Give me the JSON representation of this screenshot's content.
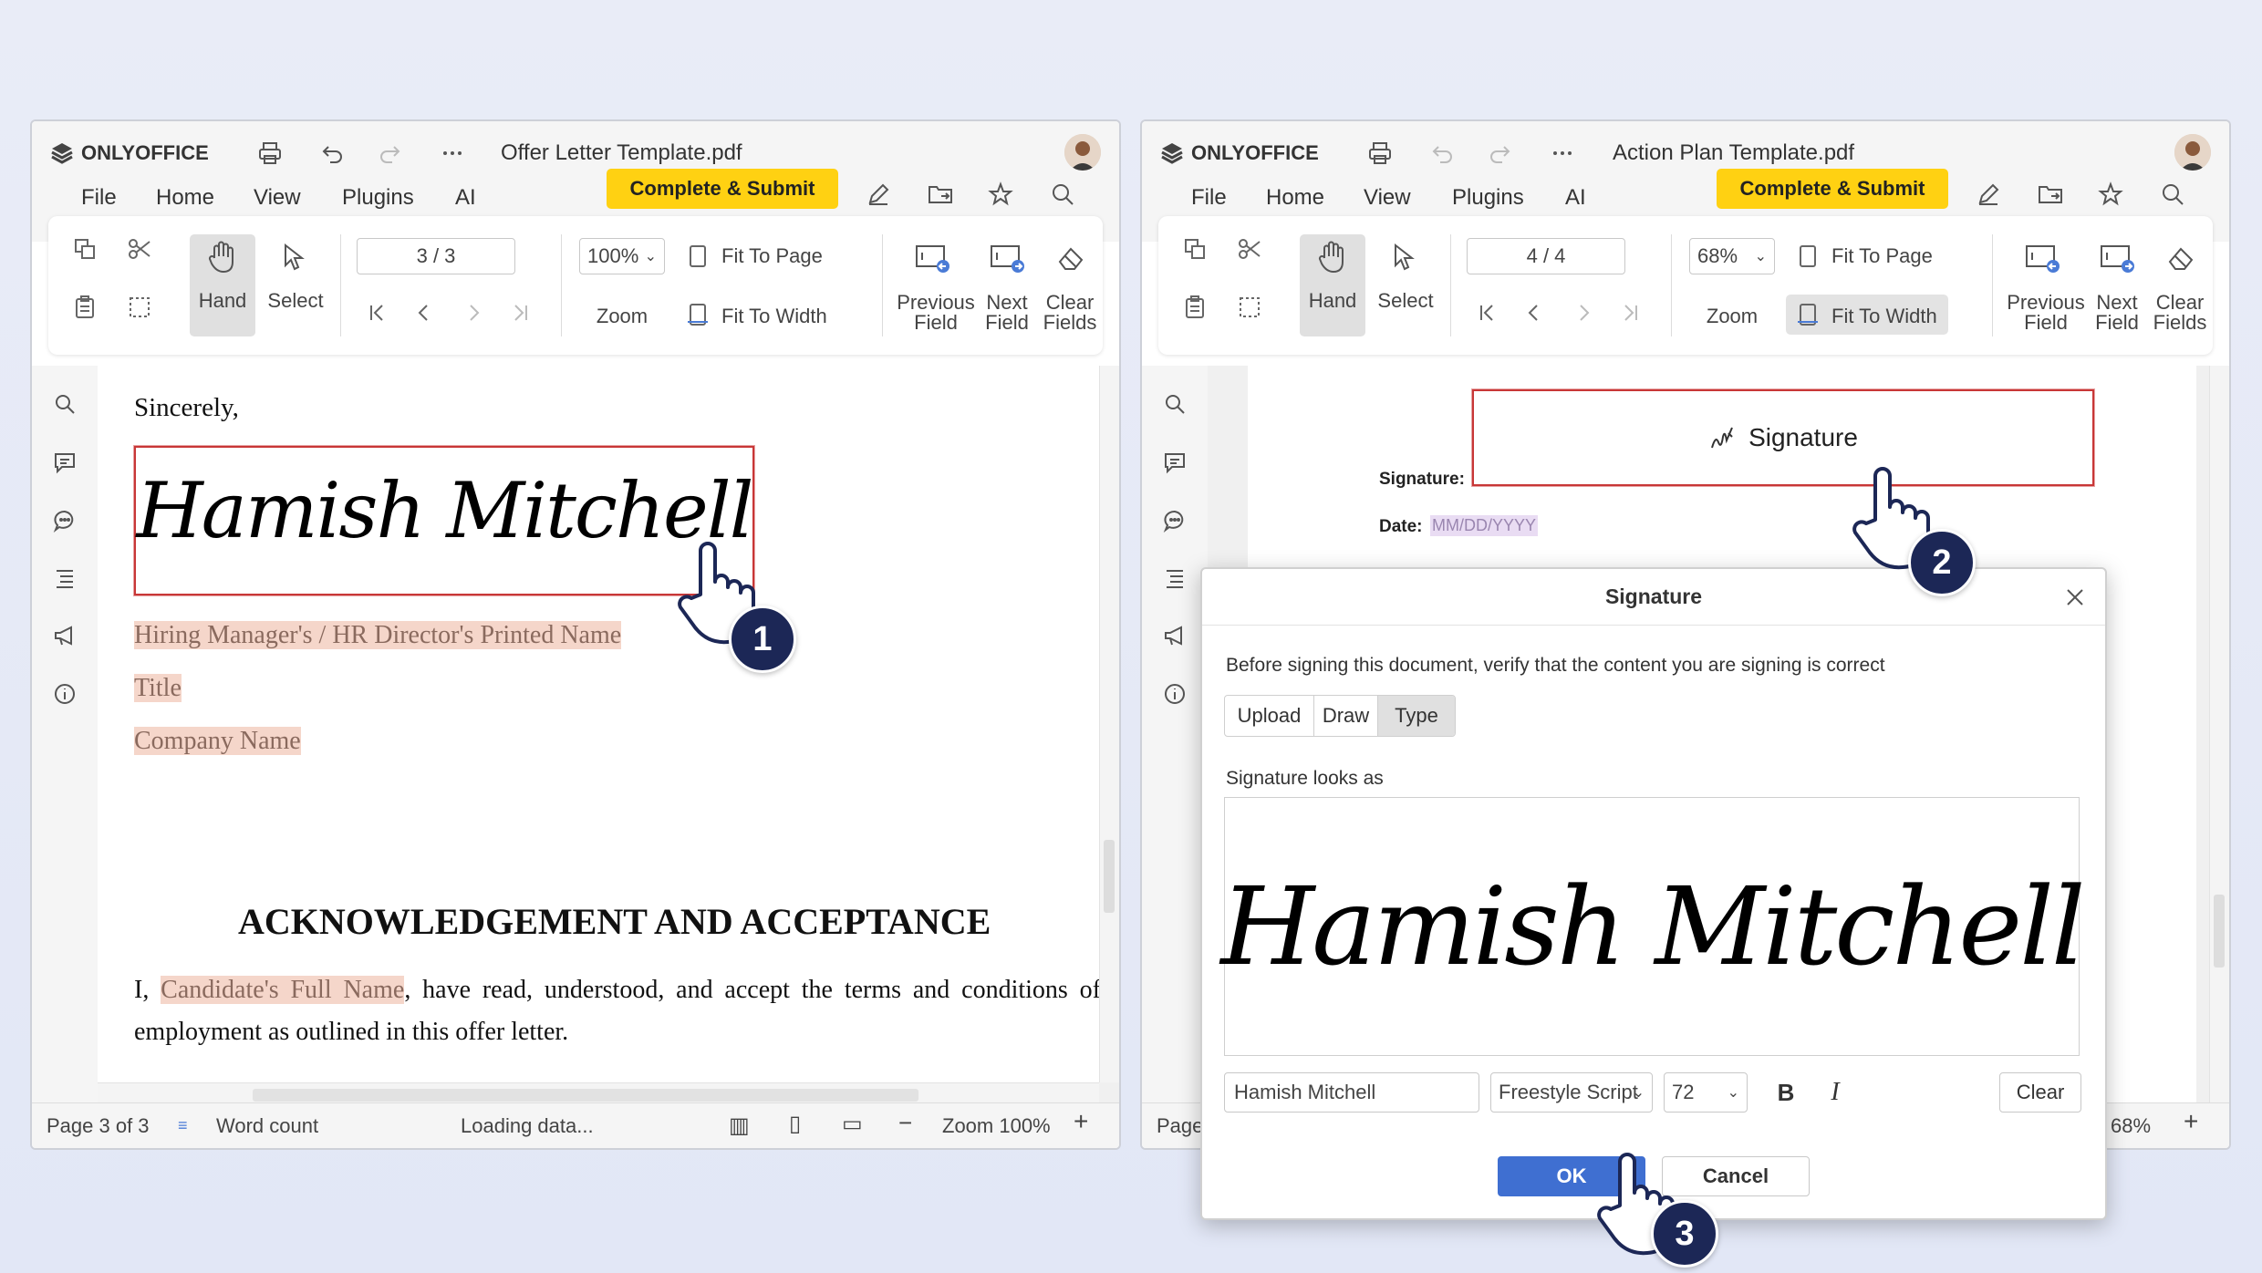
{
  "left": {
    "app_name": "ONLYOFFICE",
    "title": "Offer Letter Template.pdf",
    "menu": [
      "File",
      "Home",
      "View",
      "Plugins",
      "AI"
    ],
    "complete_submit": "Complete & Submit",
    "page_field": "3 / 3",
    "zoom": "100%",
    "labels": {
      "hand": "Hand",
      "select": "Select",
      "zoom": "Zoom",
      "fit_page": "Fit To Page",
      "fit_width": "Fit To Width",
      "prev1": "Previous",
      "prev2": "Field",
      "next1": "Next",
      "next2": "Field",
      "clear1": "Clear",
      "clear2": "Fields"
    },
    "doc": {
      "sincerely": "Sincerely,",
      "signature": "Hamish Mitchell",
      "manager": "Hiring Manager's / HR Director's Printed Name",
      "title_field": "Title",
      "company": "Company Name",
      "heading": "ACKNOWLEDGEMENT AND ACCEPTANCE",
      "para_start": "I, ",
      "candidate": "Candidate's Full Name",
      "para_rest": ", have read, understood, and accept the terms and conditions of employment as outlined in this offer letter."
    },
    "status": {
      "page": "Page 3 of 3",
      "word_count": "Word count",
      "loading": "Loading data...",
      "zoom": "Zoom 100%"
    }
  },
  "right": {
    "app_name": "ONLYOFFICE",
    "title": "Action Plan Template.pdf",
    "menu": [
      "File",
      "Home",
      "View",
      "Plugins",
      "AI"
    ],
    "complete_submit": "Complete & Submit",
    "page_field": "4 / 4",
    "zoom": "68%",
    "labels": {
      "hand": "Hand",
      "select": "Select",
      "zoom": "Zoom",
      "fit_page": "Fit To Page",
      "fit_width": "Fit To Width",
      "prev1": "Previous",
      "prev2": "Field",
      "next1": "Next",
      "next2": "Field",
      "clear1": "Clear",
      "clear2": "Fields"
    },
    "doc": {
      "sig_label": "Signature:",
      "sig_field": "Signature",
      "date_label": "Date:",
      "date_field": "MM/DD/YYYY"
    },
    "status": {
      "page": "Page",
      "zoom": "68%"
    }
  },
  "dialog": {
    "title": "Signature",
    "instruction": "Before signing this document, verify that the content you are signing is correct",
    "tabs": [
      "Upload",
      "Draw",
      "Type"
    ],
    "active_tab": "Type",
    "preview_label": "Signature looks as",
    "preview": "Hamish Mitchell",
    "name_input": "Hamish Mitchell",
    "font": "Freestyle Script",
    "size": "72",
    "bold": "B",
    "italic": "I",
    "clear": "Clear",
    "ok": "OK",
    "cancel": "Cancel"
  },
  "badges": [
    "1",
    "2",
    "3"
  ],
  "colors": {
    "accent_red": "#aa2121",
    "submit_yellow": "#ffd112",
    "badge_navy": "#1c2756",
    "ok_blue": "#3f6fd1",
    "field_highlight": "#f5d6ca"
  }
}
